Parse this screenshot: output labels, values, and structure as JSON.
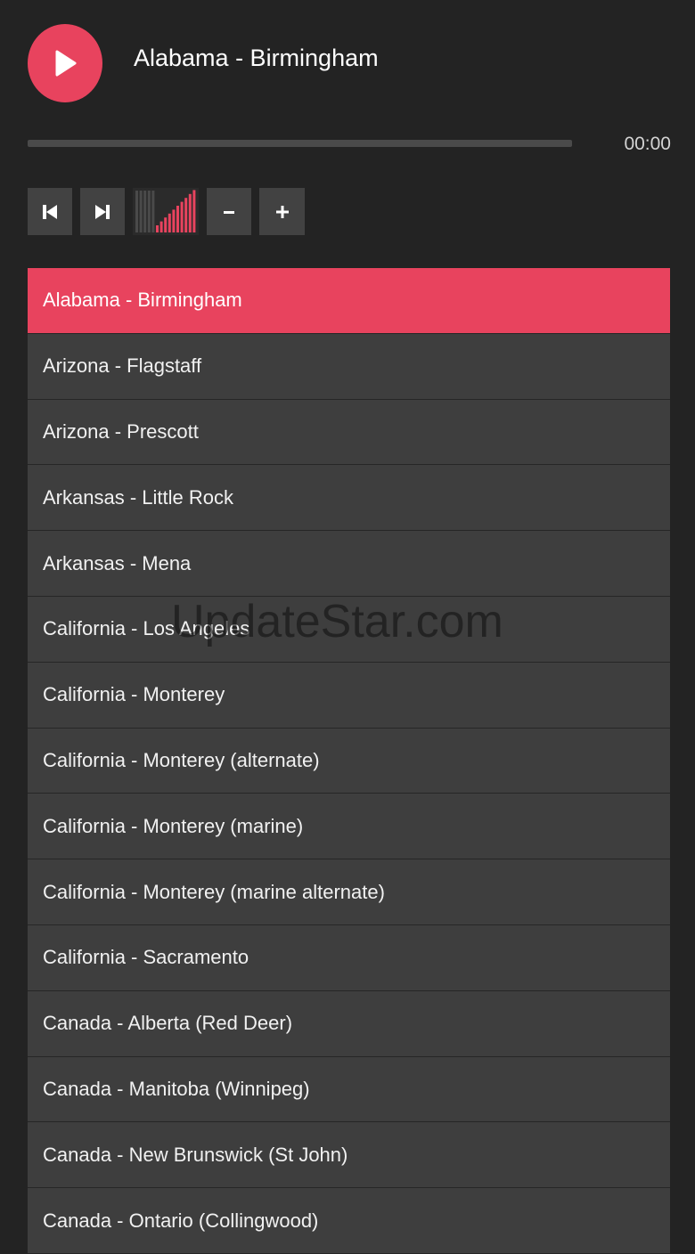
{
  "player": {
    "now_playing": "Alabama - Birmingham",
    "time": "00:00",
    "progress": 0,
    "volume_level_bars": 10,
    "volume_total_bars": 15
  },
  "controls": {
    "previous_icon": "skip-previous-icon",
    "next_icon": "skip-next-icon",
    "volume_down_label": "−",
    "volume_up_label": "+"
  },
  "playlist": [
    {
      "label": "Alabama - Birmingham",
      "active": true
    },
    {
      "label": "Arizona - Flagstaff"
    },
    {
      "label": "Arizona - Prescott"
    },
    {
      "label": "Arkansas - Little Rock"
    },
    {
      "label": "Arkansas - Mena"
    },
    {
      "label": "California - Los Angeles"
    },
    {
      "label": "California - Monterey"
    },
    {
      "label": "California - Monterey (alternate)"
    },
    {
      "label": "California - Monterey (marine)"
    },
    {
      "label": "California - Monterey (marine alternate)"
    },
    {
      "label": "California - Sacramento"
    },
    {
      "label": "Canada - Alberta (Red Deer)"
    },
    {
      "label": "Canada - Manitoba (Winnipeg)"
    },
    {
      "label": "Canada - New Brunswick (St John)"
    },
    {
      "label": "Canada - Ontario (Collingwood)"
    }
  ],
  "watermark": "UpdateStar.com",
  "colors": {
    "accent": "#e8435e",
    "background": "#232323",
    "row": "#3e3e3e"
  }
}
